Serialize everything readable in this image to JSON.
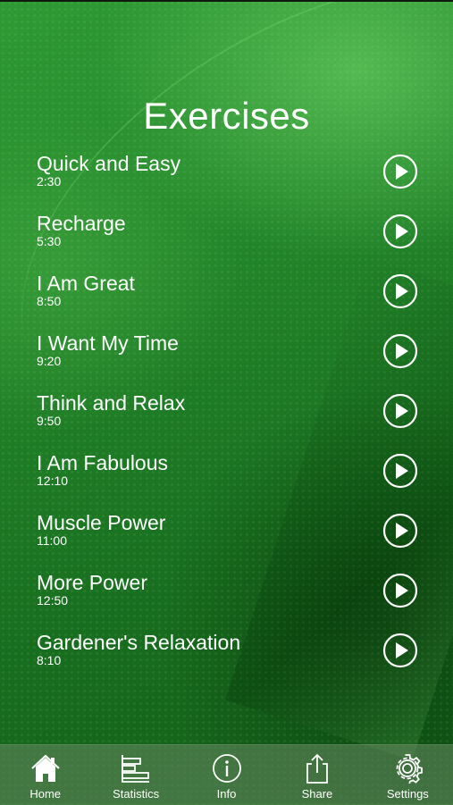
{
  "screen": {
    "title": "Exercises"
  },
  "exercises": [
    {
      "name": "Quick and Easy",
      "duration": "2:30"
    },
    {
      "name": "Recharge",
      "duration": "5:30"
    },
    {
      "name": "I Am Great",
      "duration": "8:50"
    },
    {
      "name": "I Want My Time",
      "duration": "9:20"
    },
    {
      "name": "Think and Relax",
      "duration": "9:50"
    },
    {
      "name": "I Am Fabulous",
      "duration": "12:10"
    },
    {
      "name": "Muscle Power",
      "duration": "11:00"
    },
    {
      "name": "More Power",
      "duration": "12:50"
    },
    {
      "name": "Gardener's Relaxation",
      "duration": "8:10"
    }
  ],
  "tabbar": {
    "tabs": [
      {
        "label": "Home",
        "icon": "home-icon",
        "selected": true
      },
      {
        "label": "Statistics",
        "icon": "statistics-icon",
        "selected": false
      },
      {
        "label": "Info",
        "icon": "info-icon",
        "selected": false
      },
      {
        "label": "Share",
        "icon": "share-icon",
        "selected": false
      },
      {
        "label": "Settings",
        "icon": "gear-icon",
        "selected": false
      }
    ]
  },
  "colors": {
    "background": "#1f7a26",
    "text": "#ffffff",
    "tabbar": "#5f825a"
  }
}
